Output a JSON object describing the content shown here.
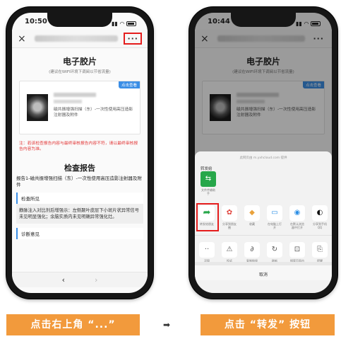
{
  "left_phone": {
    "time": "10:50",
    "close_icon": "×",
    "more_button": "···",
    "doc_title": "电子胶片",
    "doc_subtitle": "(建议在WIFI环境下调阅以节省流量)",
    "card_badge": "点击查看",
    "card_desc": "磁共振增强扫描（东）-一次性使用高压造影注射器及附件",
    "warning": "注：若该检查报告内容与最终审核报告内容不符，请以最终审核报告内容为准。",
    "report_title": "检查报告",
    "report_line": "报告1-磁共振增强扫描（东）-一次性使用高压造影注射器及附件",
    "findings_label": "检查所见",
    "findings_body": "静脉注入对比剂后增强示：左侧颞叶皮层下小斑片状异常信号未见明显强化；余脑实质内未见明确异常强化灶。",
    "diagnosis_label": "诊断意见",
    "nav_back": "‹",
    "nav_forward": "›"
  },
  "right_phone": {
    "time": "10:44",
    "sheet_header": "此网页由 m.yxhcloud.com 提供",
    "share_to_label": "转发给",
    "file_item_label": "文件传输助手",
    "row1": [
      {
        "icon": "forward-arrow-icon",
        "glyph": "➦",
        "label": "转发给朋友"
      },
      {
        "icon": "moments-icon",
        "glyph": "✿",
        "label": "分享到朋友圈"
      },
      {
        "icon": "favorite-cube-icon",
        "glyph": "◆",
        "label": "收藏"
      },
      {
        "icon": "computer-icon",
        "glyph": "▭",
        "label": "在电脑上打开"
      },
      {
        "icon": "browser-icon",
        "glyph": "◉",
        "label": "在默认浏览器中打开"
      },
      {
        "icon": "qq-icon",
        "glyph": "◐",
        "label": "分享到手机QQ"
      }
    ],
    "row2": [
      {
        "icon": "more-dots-icon",
        "glyph": "··",
        "label": "浮窗"
      },
      {
        "icon": "warning-icon",
        "glyph": "⚠",
        "label": "投诉"
      },
      {
        "icon": "link-icon",
        "glyph": "∂",
        "label": "复制链接"
      },
      {
        "icon": "refresh-icon",
        "glyph": "↻",
        "label": "刷新"
      },
      {
        "icon": "search-in-page-icon",
        "glyph": "⊡",
        "label": "搜索页面内容"
      },
      {
        "icon": "translate-icon",
        "glyph": "⎘",
        "label": "提醒"
      }
    ],
    "cancel_label": "取消"
  },
  "captions": {
    "left": "点击右上角 “...”",
    "arrow": "➡",
    "right": "点击 “转发” 按钮"
  },
  "colors": {
    "caption_bg": "#f29a3c",
    "highlight": "#e51d1d",
    "accent_blue": "#3a8ee6",
    "share_green": "#27a74a"
  }
}
